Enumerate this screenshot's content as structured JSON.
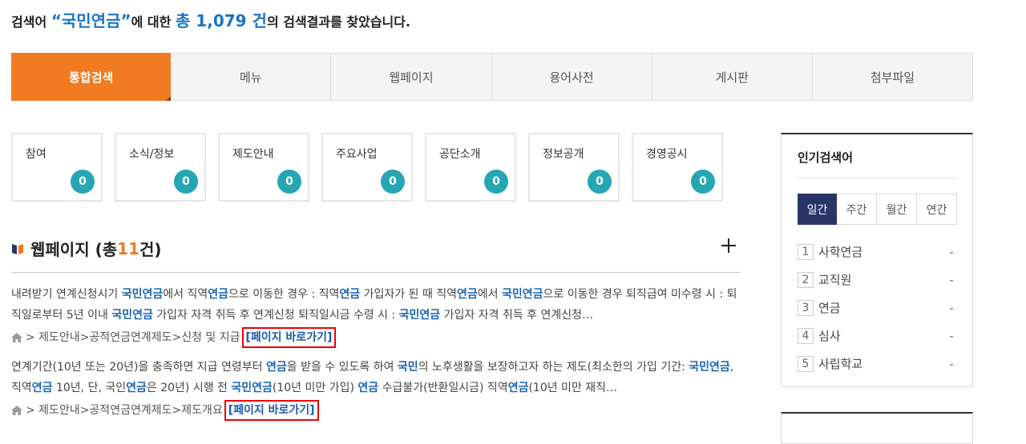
{
  "summary": {
    "prefix": "검색어 ",
    "query": "“국민연금”",
    "mid": "에 대한 ",
    "total": "총 1,079 건",
    "suffix": "의 검색결과를 찾았습니다."
  },
  "tabs": [
    "통합검색",
    "메뉴",
    "웹페이지",
    "용어사전",
    "게시판",
    "첨부파일"
  ],
  "categories": [
    {
      "label": "참여",
      "count": "0"
    },
    {
      "label": "소식/정보",
      "count": "0"
    },
    {
      "label": "제도안내",
      "count": "0"
    },
    {
      "label": "주요사업",
      "count": "0"
    },
    {
      "label": "공단소개",
      "count": "0"
    },
    {
      "label": "정보공개",
      "count": "0"
    },
    {
      "label": "경영공시",
      "count": "0"
    }
  ],
  "webpage": {
    "title_prefix": "웹페이지 (총 ",
    "count": "11",
    "title_suffix": "건)"
  },
  "results": [
    {
      "snippet": [
        [
          "내려받기 연계신청시기 ",
          false
        ],
        [
          "국민연금",
          true
        ],
        [
          "에서 직역",
          false
        ],
        [
          "연금",
          true
        ],
        [
          "으로 이동한 경우 : 직역",
          false
        ],
        [
          "연금",
          true
        ],
        [
          " 가입자가 된 때 직역",
          false
        ],
        [
          "연금",
          true
        ],
        [
          "에서 ",
          false
        ],
        [
          "국민연금",
          true
        ],
        [
          "으로 이동한 경우 퇴직급여 미수령 시 : 퇴직일로부터 5년 이내 ",
          false
        ],
        [
          "국민연금",
          true
        ],
        [
          " 가입자 자격 취득 후 연계신청 퇴직일시금 수령 시 : ",
          false
        ],
        [
          "국민연금",
          true
        ],
        [
          " 가입자 자격 취득 후 연계신청…",
          false
        ]
      ],
      "path": "> 제도안내>공적연금연계제도>신청 및 지급",
      "link": "[페이지 바로가기]"
    },
    {
      "snippet": [
        [
          "연계기간(10년 또는 20년)을 충족하면 지급 연령부터 ",
          false
        ],
        [
          "연금",
          true
        ],
        [
          "을 받을 수 있도록 하여 ",
          false
        ],
        [
          "국민",
          true
        ],
        [
          "의 노후생활을 보장하고자 하는 제도(최소한의 가입 기간: ",
          false
        ],
        [
          "국민연금",
          true
        ],
        [
          ", 직역",
          false
        ],
        [
          "연금",
          true
        ],
        [
          " 10년, 단, 국인",
          false
        ],
        [
          "연금",
          true
        ],
        [
          "은 20년) 시행 전 ",
          false
        ],
        [
          "국민연금",
          true
        ],
        [
          "(10년 미만 가입) ",
          false
        ],
        [
          "연금",
          true
        ],
        [
          " 수급불가(반환일시금) 직역",
          false
        ],
        [
          "연금",
          true
        ],
        [
          "(10년 미만 재직…",
          false
        ]
      ],
      "path": "> 제도안내>공적연금연계제도>제도개요",
      "link": "[페이지 바로가기]"
    }
  ],
  "popular": {
    "title": "인기검색어",
    "periods": [
      "일간",
      "주간",
      "월간",
      "연간"
    ],
    "items": [
      {
        "rank": "1",
        "term": "사학연금",
        "change": "-"
      },
      {
        "rank": "2",
        "term": "교직원",
        "change": "-"
      },
      {
        "rank": "3",
        "term": "연금",
        "change": "-"
      },
      {
        "rank": "4",
        "term": "심사",
        "change": "-"
      },
      {
        "rank": "5",
        "term": "사립학교",
        "change": "-"
      }
    ]
  }
}
